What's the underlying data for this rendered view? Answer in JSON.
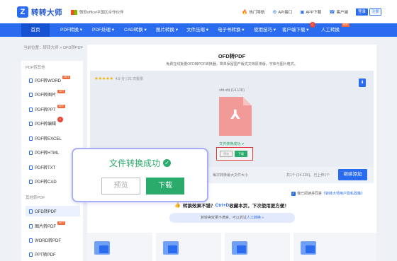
{
  "header": {
    "logo_text": "转转大师",
    "partner_text": "微软office中国区合作伙伴",
    "links": [
      {
        "icon": "fire-icon",
        "glyph": "🔥",
        "label": "热门导航"
      },
      {
        "icon": "code-icon",
        "glyph": "⚙",
        "label": "API接口"
      },
      {
        "icon": "app-icon",
        "glyph": "▣",
        "label": "APP下载"
      },
      {
        "icon": "service-icon",
        "glyph": "☎",
        "label": "客户端"
      }
    ],
    "login": "登录",
    "register": "注册"
  },
  "nav": {
    "home": "首页",
    "items": [
      "PDF转换",
      "PDF处理",
      "CAD转换",
      "图片转换",
      "文件压缩",
      "电子书转换",
      "使用技巧",
      "客户端下载",
      "人工转换"
    ],
    "hot_badge": "HOT"
  },
  "breadcrumb": "当前位置：转转大师 > OFD转PDF",
  "sidebar": {
    "group1_title": "PDF转其他",
    "group1": [
      {
        "label": "PDF转WORD",
        "hot": true
      },
      {
        "label": "PDF转图片",
        "hot": true
      },
      {
        "label": "PDF转PPT",
        "hot": true
      },
      {
        "label": "PDF转编辑",
        "hot": false
      },
      {
        "label": "PDF转EXCEL",
        "hot": false
      },
      {
        "label": "PDF转HTML",
        "hot": false
      },
      {
        "label": "PDF转TXT",
        "hot": false
      },
      {
        "label": "PDF转CAD",
        "hot": false
      }
    ],
    "group2_title": "其他转PDF",
    "group2": [
      {
        "label": "OFD转PDF",
        "hot": false
      },
      {
        "label": "图片转PDF",
        "hot": true
      },
      {
        "label": "WORD转PDF",
        "hot": false
      },
      {
        "label": "PPT转PDF",
        "hot": false
      }
    ]
  },
  "main": {
    "title": "OFD转PDF",
    "subtitle": "免费在线批量OFD转PDF转换器，简单保留国产版式文档原排版，字体与图片格式。",
    "rating_stars": 5,
    "rating_text": "4.9 分 | 31 次投票",
    "file_name": "ofd.ofd (14.12K)",
    "file_status": "文件转换成功",
    "mini_preview": "预览",
    "mini_download": "下载",
    "filebar_hint": "每次转换最大文件大小",
    "filebar_count": "共1个 (14.12K)，已上传1个",
    "add_button": "继续添加",
    "agree_text": "我已阅读并同意",
    "agree_link": "《转转大师用户隐私政策》",
    "unsat_pre": "转换效果不错？",
    "unsat_keys": "Ctrl+D",
    "unsat_post": "收藏本页，下次使用更方便！",
    "manual_pre": "若转换效果不满意，可以尝试",
    "manual_link": "人工转换 »"
  },
  "overlay": {
    "title": "文件转换成功",
    "preview": "预览",
    "download": "下载"
  },
  "colors": {
    "brand": "#2a6bef",
    "success": "#2aab6c",
    "highlight": "#e0373b"
  }
}
